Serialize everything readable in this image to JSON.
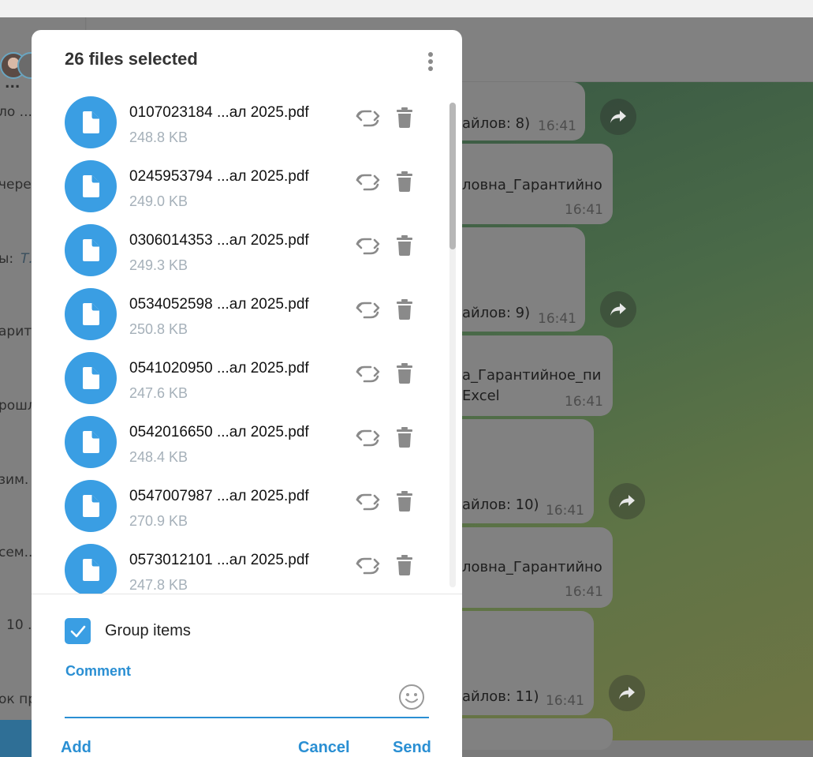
{
  "background": {
    "chat_list_snippets": [
      "...",
      "ло ...",
      "чере",
      "ы:",
      "Т.",
      "арит.",
      "рошл",
      "зим.",
      "сем..",
      "10 ...",
      "ок пр"
    ],
    "chat_messages": [
      {
        "text": "айлов: 8)",
        "time": "16:41"
      },
      {
        "text": "ловна_Гарантийно",
        "time": "16:41"
      },
      {
        "text": "айлов: 9)",
        "time": "16:41"
      },
      {
        "text": "а_Гарантийное_пи",
        "text2": "Excel",
        "time": "16:41"
      },
      {
        "text": "айлов: 10)",
        "time": "16:41"
      },
      {
        "text": "ловна_Гарантийно",
        "time": "16:41"
      },
      {
        "text": "айлов: 11)",
        "time": "16:41"
      }
    ]
  },
  "modal": {
    "title": "26 files selected",
    "files": [
      {
        "name": "0107023184 ...ал 2025.pdf",
        "size": "248.8 KB"
      },
      {
        "name": "0245953794 ...ал 2025.pdf",
        "size": "249.0 KB"
      },
      {
        "name": "0306014353 ...ал 2025.pdf",
        "size": "249.3 KB"
      },
      {
        "name": "0534052598 ...ал 2025.pdf",
        "size": "250.8 KB"
      },
      {
        "name": "0541020950 ...ал 2025.pdf",
        "size": "247.6 KB"
      },
      {
        "name": "0542016650 ...ал 2025.pdf",
        "size": "248.4 KB"
      },
      {
        "name": "0547007987 ...ал 2025.pdf",
        "size": "270.9 KB"
      },
      {
        "name": "0573012101 ...ал 2025.pdf",
        "size": "247.8 KB"
      }
    ],
    "group_items": {
      "label": "Group items",
      "checked": true
    },
    "comment": {
      "label": "Comment",
      "value": "",
      "placeholder": ""
    },
    "buttons": {
      "add": "Add",
      "cancel": "Cancel",
      "send": "Send"
    }
  },
  "icons": {
    "file": "file-icon",
    "replace": "replace-icon",
    "delete": "trash-icon",
    "more": "more-vertical-icon",
    "emoji": "emoji-icon",
    "forward": "forward-icon",
    "check": "checkmark-icon"
  },
  "colors": {
    "accent": "#3a9ee3",
    "link": "#2a8fd3",
    "file_size": "#a5b0b9"
  }
}
